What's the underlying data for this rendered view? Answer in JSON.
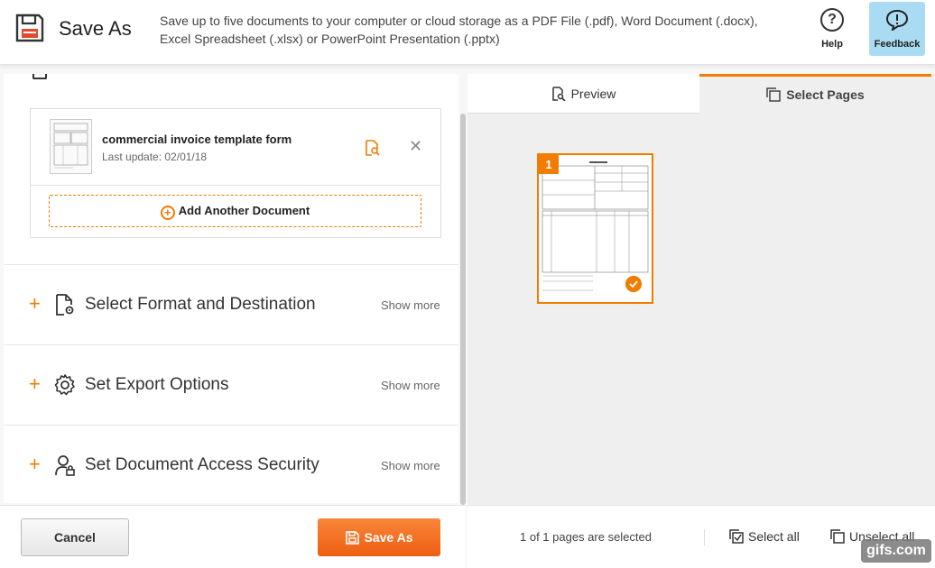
{
  "header": {
    "title": "Save As",
    "description": "Save up to five documents to your computer or cloud storage as a PDF File (.pdf), Word Document (.docx), Excel Spreadsheet (.xlsx) or PowerPoint Presentation (.pptx)",
    "help_label": "Help",
    "feedback_label": "Feedback",
    "icons": {
      "title": "floppy-disk-icon",
      "help": "question-circle-icon",
      "feedback": "speech-bubble-icon"
    }
  },
  "document": {
    "name": "commercial invoice template form",
    "last_update": "Last update: 02/01/18",
    "add_another_label": "Add Another Document"
  },
  "sections": [
    {
      "title": "Select Format and Destination",
      "show_more": "Show more",
      "icon": "file-gear-icon"
    },
    {
      "title": "Set Export Options",
      "show_more": "Show more",
      "icon": "gear-icon"
    },
    {
      "title": "Set Document Access Security",
      "show_more": "Show more",
      "icon": "user-lock-icon"
    }
  ],
  "tabs": {
    "preview": "Preview",
    "select_pages": "Select Pages",
    "active": "Select Pages"
  },
  "pages": [
    {
      "number": "1",
      "selected": true
    }
  ],
  "footer": {
    "cancel_label": "Cancel",
    "save_label": "Save As",
    "pages_status": "1 of 1 pages are selected",
    "select_all": "Select all",
    "unselect_all": "Unselect all"
  },
  "watermark": "gifs.com",
  "colors": {
    "accent": "#f07c00",
    "save_button": "#f26b1d",
    "feedback_bg": "#a9dcf3"
  }
}
